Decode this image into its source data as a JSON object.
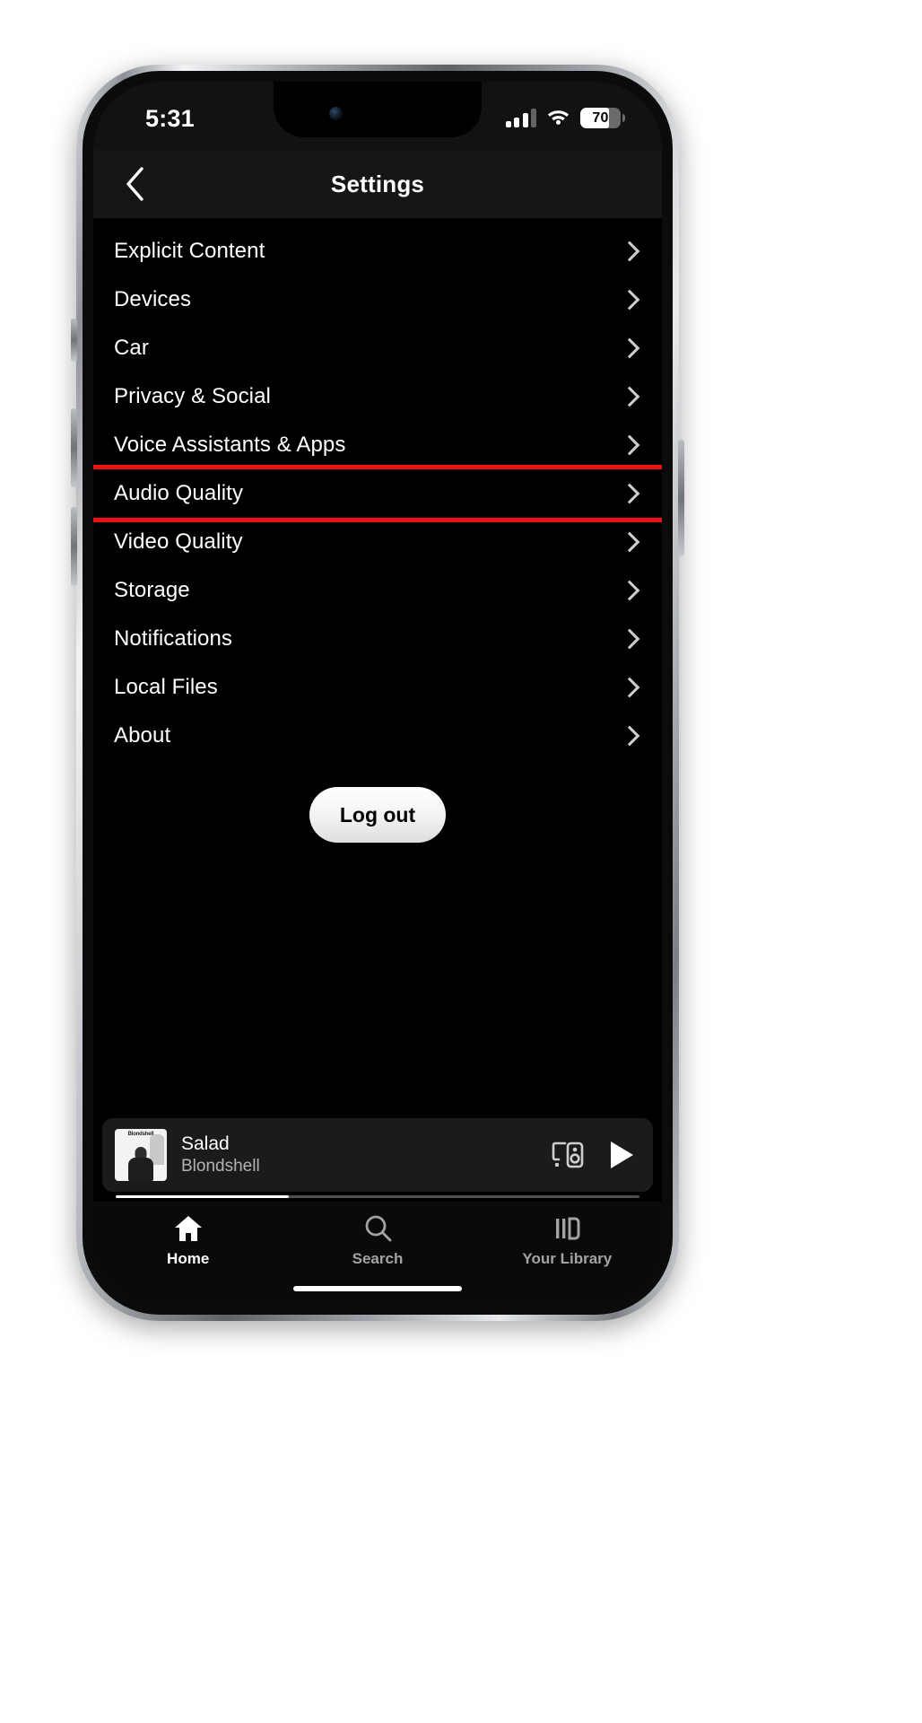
{
  "status_bar": {
    "time": "5:31",
    "battery_percent": "70",
    "battery_level": 70,
    "signal_bars_filled": 3,
    "signal_bars_total": 4,
    "wifi": "wifi-icon"
  },
  "header": {
    "title": "Settings",
    "back_icon": "chevron-left-icon"
  },
  "settings": {
    "chevron_icon": "chevron-right-icon",
    "highlight_color": "#ee1111",
    "items": [
      {
        "label": "Explicit Content",
        "highlighted": false
      },
      {
        "label": "Devices",
        "highlighted": false
      },
      {
        "label": "Car",
        "highlighted": false
      },
      {
        "label": "Privacy & Social",
        "highlighted": false
      },
      {
        "label": "Voice Assistants & Apps",
        "highlighted": false
      },
      {
        "label": "Audio Quality",
        "highlighted": true
      },
      {
        "label": "Video Quality",
        "highlighted": false
      },
      {
        "label": "Storage",
        "highlighted": false
      },
      {
        "label": "Notifications",
        "highlighted": false
      },
      {
        "label": "Local Files",
        "highlighted": false
      },
      {
        "label": "About",
        "highlighted": false
      }
    ]
  },
  "logout": {
    "label": "Log out"
  },
  "now_playing": {
    "title": "Salad",
    "artist": "Blondshell",
    "album_art_title": "Blondshell",
    "connect_icon": "spotify-connect-device-icon",
    "play_icon": "play-icon",
    "progress_percent": 33
  },
  "tab_bar": {
    "tabs": [
      {
        "label": "Home",
        "icon": "home-icon",
        "active": true
      },
      {
        "label": "Search",
        "icon": "search-icon",
        "active": false
      },
      {
        "label": "Your Library",
        "icon": "library-icon",
        "active": false
      }
    ]
  }
}
